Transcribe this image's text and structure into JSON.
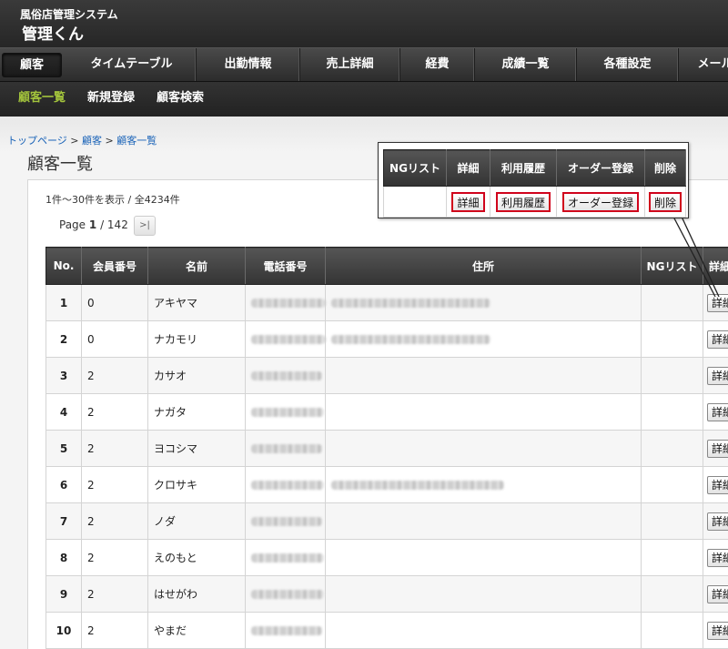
{
  "header": {
    "system_name": "風俗店管理システム",
    "app_title": "管理くん"
  },
  "main_nav": [
    {
      "label": "顧客",
      "active": true
    },
    {
      "label": "タイムテーブル"
    },
    {
      "label": "出勤情報"
    },
    {
      "label": "売上詳細"
    },
    {
      "label": "経費"
    },
    {
      "label": "成績一覧"
    },
    {
      "label": "各種設定"
    },
    {
      "label": "メール"
    }
  ],
  "sub_nav": [
    {
      "label": "顧客一覧",
      "active": true
    },
    {
      "label": "新規登録"
    },
    {
      "label": "顧客検索"
    }
  ],
  "breadcrumb": {
    "home": "トップページ",
    "sep1": " > ",
    "section": "顧客",
    "sep2": " > ",
    "current": "顧客一覧"
  },
  "page_title": "顧客一覧",
  "pagination": {
    "summary": "1件～30件を表示 / 全4234件",
    "page_label": "Page",
    "current_page": "1",
    "sep": " / ",
    "total_pages": "142",
    "next_label": ">|"
  },
  "table": {
    "headers": [
      "No.",
      "会員番号",
      "名前",
      "電話番号",
      "住所",
      "NGリスト",
      "詳細"
    ],
    "detail_button_label": "詳細",
    "rows": [
      {
        "no": "1",
        "member_no": "0",
        "name": "アキヤマ"
      },
      {
        "no": "2",
        "member_no": "0",
        "name": "ナカモリ"
      },
      {
        "no": "3",
        "member_no": "2",
        "name": "カサオ"
      },
      {
        "no": "4",
        "member_no": "2",
        "name": "ナガタ"
      },
      {
        "no": "5",
        "member_no": "2",
        "name": "ヨコシマ"
      },
      {
        "no": "6",
        "member_no": "2",
        "name": "クロサキ"
      },
      {
        "no": "7",
        "member_no": "2",
        "name": "ノダ"
      },
      {
        "no": "8",
        "member_no": "2",
        "name": "えのもと"
      },
      {
        "no": "9",
        "member_no": "2",
        "name": "はせがわ"
      },
      {
        "no": "10",
        "member_no": "2",
        "name": "やまだ"
      }
    ]
  },
  "callout": {
    "headers": [
      "NGリスト",
      "詳細",
      "利用履歴",
      "オーダー登録",
      "削除"
    ],
    "buttons": {
      "detail": "詳細",
      "history": "利用履歴",
      "order": "オーダー登録",
      "delete": "削除"
    }
  },
  "colors": {
    "accent_green": "#a3c43c",
    "highlight_red": "#d0021b",
    "link_blue": "#1a63b8"
  }
}
